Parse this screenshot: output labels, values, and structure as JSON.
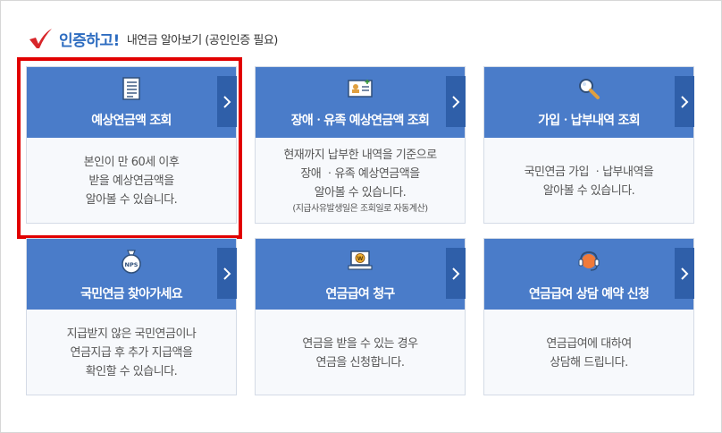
{
  "header": {
    "title_strong": "인증하고!",
    "title_sub": "내연금 알아보기 (공인인증 필요)"
  },
  "colors": {
    "card_top": "#4a7cc9",
    "card_arrow": "#2f5fa9",
    "accent_text": "#2d6cc0",
    "selected_border": "#e10000",
    "check": "#d8262a"
  },
  "cards": [
    {
      "icon": "document-list-icon",
      "title": "예상연금액 조회",
      "lines": [
        "본인이 만 60세 이후",
        "받을 예상연금액을",
        "알아볼 수 있습니다."
      ],
      "selected": true
    },
    {
      "icon": "id-card-icon",
      "title": "장애ㆍ유족 예상연금액 조회",
      "lines": [
        "현재까지 납부한 내역을 기준으로",
        "장애 ㆍ유족 예상연금액을",
        "알아볼 수 있습니다."
      ],
      "note": "(지급사유발생일은 조회일로 자동계산)"
    },
    {
      "icon": "magnifier-icon",
      "title": "가입ㆍ납부내역 조회",
      "lines": [
        "국민연금 가입 ㆍ납부내역을",
        "알아볼 수 있습니다."
      ]
    },
    {
      "icon": "nps-pouch-icon",
      "title": "국민연금 찾아가세요",
      "lines": [
        "지급받지 않은 국민연금이나",
        "연금지급 후 추가 지급액을",
        "확인할 수 있습니다."
      ]
    },
    {
      "icon": "won-laptop-icon",
      "title": "연금급여 청구",
      "lines": [
        "연금을 받을 수 있는 경우",
        "연금을 신청합니다."
      ]
    },
    {
      "icon": "headset-icon",
      "title": "연금급여 상담 예약 신청",
      "lines": [
        "연금급여에 대하여",
        "상담해 드립니다."
      ]
    }
  ]
}
